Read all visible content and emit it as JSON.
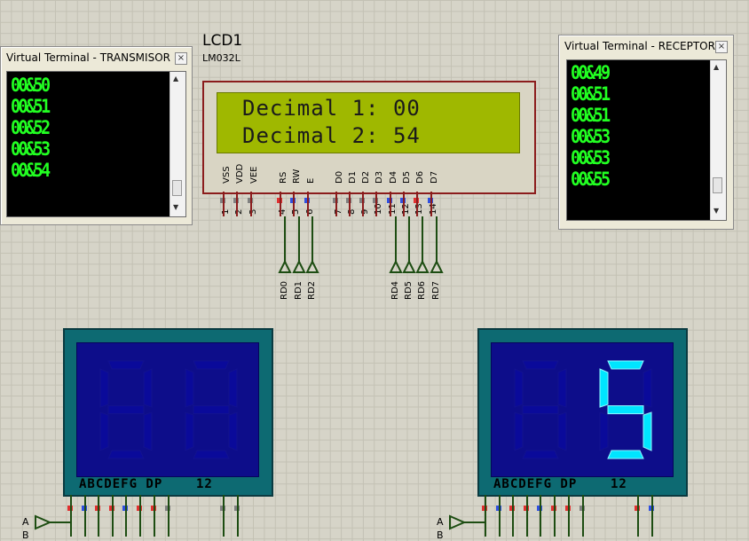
{
  "terminal_tx": {
    "title": "Virtual Terminal - TRANSMISOR",
    "close_glyph": "×",
    "lines": [
      "00&50",
      "00&51",
      "00&52",
      "00&53",
      "00&54"
    ]
  },
  "terminal_rx": {
    "title": "Virtual Terminal - RECEPTOR",
    "close_glyph": "×",
    "lines": [
      "00&49",
      "00&51",
      "00&51",
      "00&53",
      "00&53",
      "00&55"
    ]
  },
  "lcd": {
    "name": "LCD1",
    "model": "LM032L",
    "line1": "Decimal 1: 00",
    "line2": "Decimal 2: 54",
    "pin_labels": [
      "VSS",
      "VDD",
      "VEE",
      "RS",
      "RW",
      "E",
      "D0",
      "D1",
      "D2",
      "D3",
      "D4",
      "D5",
      "D6",
      "D7"
    ],
    "pin_numbers": [
      "1",
      "2",
      "3",
      "4",
      "5",
      "6",
      "7",
      "8",
      "9",
      "10",
      "11",
      "12",
      "13",
      "14"
    ]
  },
  "ports": [
    "RD0",
    "RD1",
    "RD2",
    "RD4",
    "RD5",
    "RD6",
    "RD7"
  ],
  "display_left": {
    "footer": "ABCDEFG DP    12",
    "digit1": "",
    "digit2": ""
  },
  "display_right": {
    "footer": "ABCDEFG DP    12",
    "digit1": "",
    "digit2": "5"
  },
  "inputs": [
    "A",
    "B"
  ],
  "colors": {
    "terminal_text": "#22ff22",
    "lcd_screen": "#9fb800",
    "segment_on": "#00e5ff",
    "segment_off": "#0a0a9a",
    "wire": "#1d4d12",
    "component_border": "#8b1c1c"
  }
}
